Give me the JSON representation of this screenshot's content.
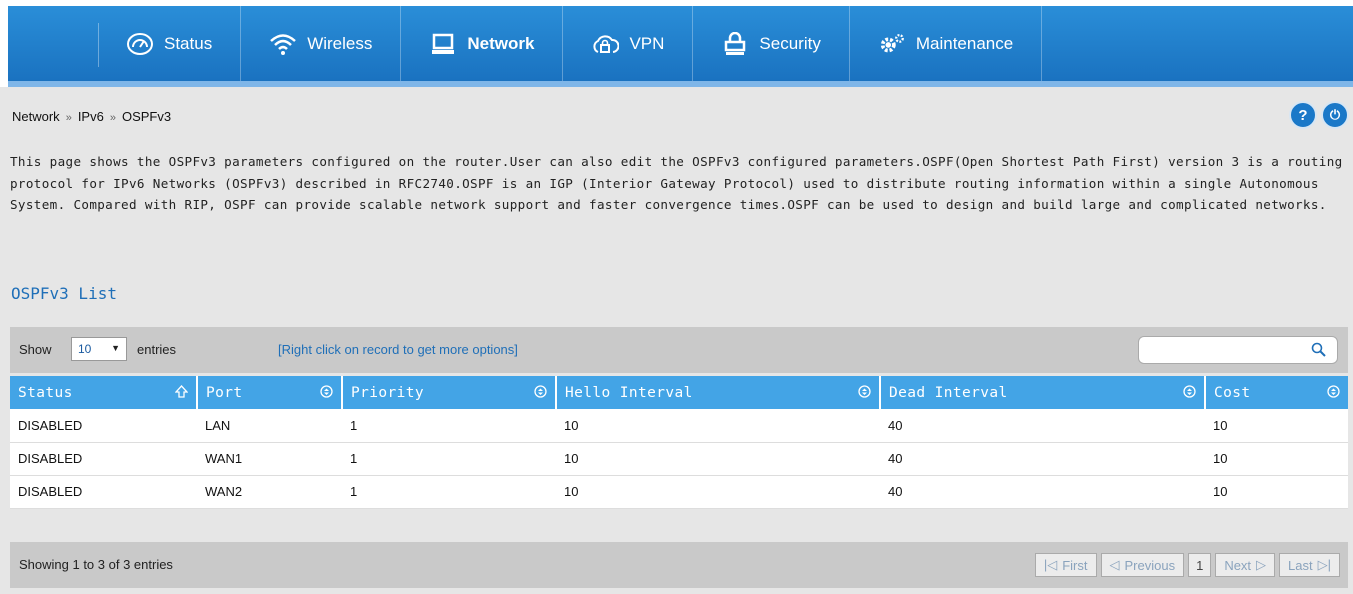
{
  "nav": {
    "items": [
      {
        "label": "Status",
        "icon": "speedometer-icon"
      },
      {
        "label": "Wireless",
        "icon": "wifi-icon"
      },
      {
        "label": "Network",
        "icon": "monitor-icon",
        "active": true
      },
      {
        "label": "VPN",
        "icon": "cloud-lock-icon"
      },
      {
        "label": "Security",
        "icon": "lock-icon"
      },
      {
        "label": "Maintenance",
        "icon": "gears-icon"
      }
    ]
  },
  "breadcrumb": {
    "items": [
      "Network",
      "IPv6",
      "OSPFv3"
    ],
    "separator": "»"
  },
  "help": {
    "help_label": "?",
    "logout_label": "⏻"
  },
  "description": "This page shows the OSPFv3 parameters configured on the router.User can also edit the OSPFv3 configured parameters.OSPF(Open Shortest Path First) version 3 is a routing protocol for IPv6 Networks (OSPFv3) described in RFC2740.OSPF is an IGP (Interior Gateway Protocol) used to distribute routing information within a single Autonomous System. Compared with RIP, OSPF can provide scalable network support and faster convergence times.OSPF can be used to design and build large and complicated networks.",
  "list_title": "OSPFv3 List",
  "toolbar": {
    "show_label": "Show",
    "page_size": "10",
    "entries_label": "entries",
    "hint": "[Right click on record to get more options]",
    "search_placeholder": ""
  },
  "table": {
    "columns": [
      "Status",
      "Port",
      "Priority",
      "Hello Interval",
      "Dead Interval",
      "Cost"
    ],
    "rows": [
      [
        "DISABLED",
        "LAN",
        "1",
        "10",
        "40",
        "10"
      ],
      [
        "DISABLED",
        "WAN1",
        "1",
        "10",
        "40",
        "10"
      ],
      [
        "DISABLED",
        "WAN2",
        "1",
        "10",
        "40",
        "10"
      ]
    ]
  },
  "footer": {
    "info": "Showing 1 to 3 of 3 entries",
    "first": "First",
    "previous": "Previous",
    "current_page": "1",
    "next": "Next",
    "last": "Last"
  },
  "colors": {
    "nav": "#1a72c0",
    "header": "#43a4e6",
    "accent_text": "#1f6fb8"
  }
}
